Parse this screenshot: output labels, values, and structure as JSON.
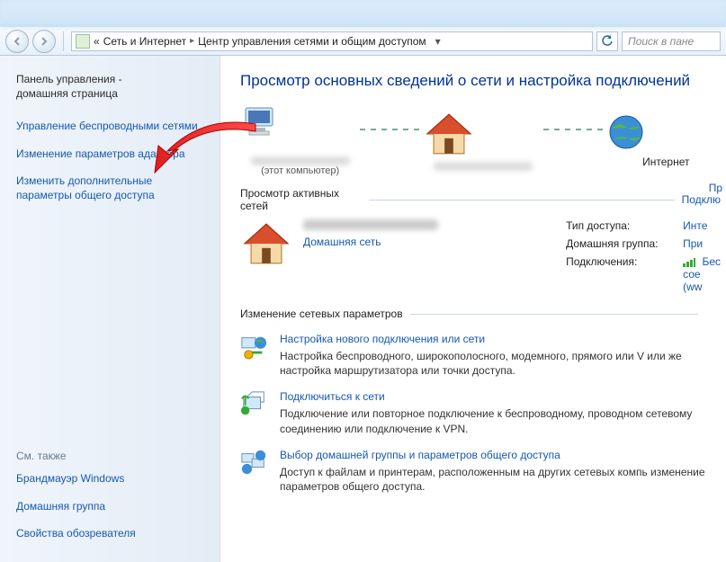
{
  "breadcrumb": {
    "root_symbol": "«",
    "level1": "Сеть и Интернет",
    "level2": "Центр управления сетями и общим доступом"
  },
  "search": {
    "placeholder": "Поиск в пане"
  },
  "sidebar": {
    "home1": "Панель управления -",
    "home2": "домашняя страница",
    "links": [
      "Управление беспроводными сетями",
      "Изменение параметров адаптера",
      "Изменить дополнительные параметры общего доступа"
    ],
    "see_also_title": "См. также",
    "see_also": [
      "Брандмауэр Windows",
      "Домашняя группа",
      "Свойства обозревателя"
    ]
  },
  "main": {
    "title": "Просмотр основных сведений о сети и настройка подключений",
    "map": {
      "this_pc_sub": "(этот компьютер)",
      "internet": "Интернет",
      "see_full": "Пр"
    },
    "active_section": "Просмотр активных сетей",
    "active_right": "Подклю",
    "network_type": "Домашняя сеть",
    "props": {
      "k1": "Тип доступа:",
      "v1": "Инте",
      "k2": "Домашняя группа:",
      "v2": "При",
      "k3": "Подключения:",
      "v3a": "Бес",
      "v3b": "сое",
      "v3c": "(ww"
    },
    "change_section": "Изменение сетевых параметров",
    "tasks": [
      {
        "title": "Настройка нового подключения или сети",
        "desc": "Настройка беспроводного, широкополосного, модемного, прямого или V или же настройка маршрутизатора или точки доступа."
      },
      {
        "title": "Подключиться к сети",
        "desc": "Подключение или повторное подключение к беспроводному, проводном сетевому соединению или подключение к VPN."
      },
      {
        "title": "Выбор домашней группы и параметров общего доступа",
        "desc": "Доступ к файлам и принтерам, расположенным на других сетевых компь изменение параметров общего доступа."
      }
    ]
  }
}
